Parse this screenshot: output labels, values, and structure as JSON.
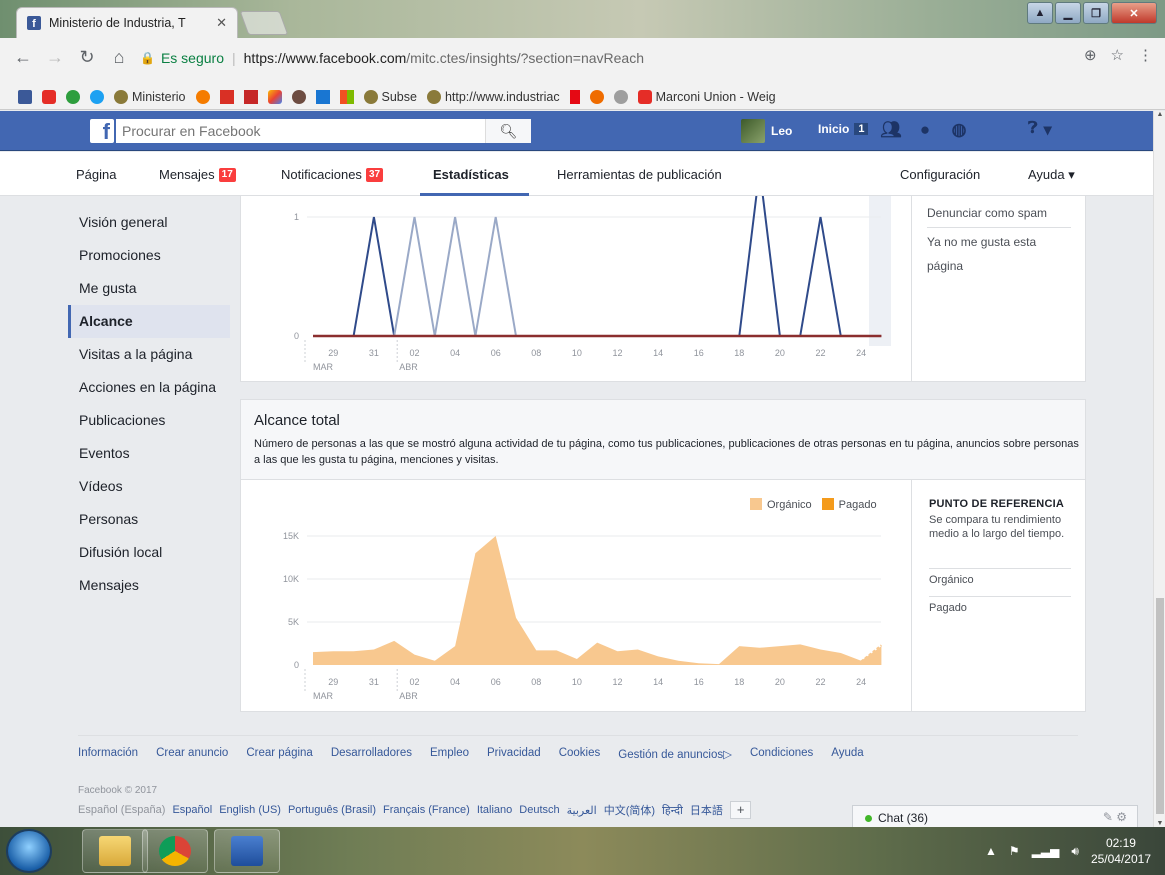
{
  "browser": {
    "tab_title": "Ministerio de Industria, T",
    "tab_close": "✕",
    "secure_label": "Es seguro",
    "url_host": "https://www.facebook.com",
    "url_path": "/mitc.ctes/insights/?section=navReach",
    "bookmarks": [
      "Ministerio",
      "Subse",
      "http://www.industriac",
      "Marconi Union - Weig"
    ]
  },
  "fb": {
    "search_placeholder": "Procurar en Facebook",
    "user_name": "Leo",
    "home_label": "Inicio",
    "home_count": "1"
  },
  "pagenav": {
    "pagina": "Página",
    "mensajes": "Mensajes",
    "mensajes_badge": "17",
    "notificaciones": "Notificaciones",
    "notificaciones_badge": "37",
    "estadisticas": "Estadísticas",
    "herramientas": "Herramientas de publicación",
    "configuracion": "Configuración",
    "ayuda": "Ayuda ▾"
  },
  "sidebar": {
    "items": [
      {
        "label": "Visión general"
      },
      {
        "label": "Promociones"
      },
      {
        "label": "Me gusta"
      },
      {
        "label": "Alcance"
      },
      {
        "label": "Visitas a la página"
      },
      {
        "label": "Acciones en la página"
      },
      {
        "label": "Publicaciones"
      },
      {
        "label": "Eventos"
      },
      {
        "label": "Vídeos"
      },
      {
        "label": "Personas"
      },
      {
        "label": "Difusión local"
      },
      {
        "label": "Mensajes"
      }
    ],
    "active_index": 3
  },
  "panel1": {
    "side_links": [
      "Denunciar como spam",
      "Ya no me gusta esta",
      "página"
    ]
  },
  "panel2": {
    "title": "Alcance total",
    "description": "Número de personas a las que se mostró alguna actividad de tu página, como tus publicaciones, publicaciones de otras personas en tu página, anuncios sobre personas a las que les gusta tu página, menciones y visitas.",
    "legend_organic": "Orgánico",
    "legend_paid": "Pagado",
    "ref_title": "PUNTO DE REFERENCIA",
    "ref_desc": "Se compara tu rendimiento medio a lo largo del tiempo.",
    "ref_organic": "Orgánico",
    "ref_paid": "Pagado"
  },
  "chart_data": [
    {
      "type": "line",
      "x": [
        "28 MAR",
        "29",
        "30",
        "31",
        "01 ABR",
        "02",
        "03",
        "04",
        "05",
        "06",
        "07",
        "08",
        "09",
        "10",
        "11",
        "12",
        "13",
        "14",
        "15",
        "16",
        "17",
        "18",
        "19",
        "20",
        "21",
        "22",
        "23",
        "24",
        "25"
      ],
      "x_tick_labels": [
        "29",
        "31",
        "02",
        "04",
        "06",
        "08",
        "10",
        "12",
        "14",
        "16",
        "18",
        "20",
        "22",
        "24"
      ],
      "x_group_labels": [
        "MAR",
        "ABR"
      ],
      "y_tick_labels": [
        "0",
        "1"
      ],
      "ylim": [
        0,
        1
      ],
      "series": [
        {
          "color": "#2f4a8a",
          "values": [
            0,
            0,
            0,
            1,
            0,
            0,
            0,
            0,
            0,
            0,
            0,
            0,
            0,
            0,
            0,
            0,
            0,
            0,
            0,
            0,
            0,
            0,
            1.4,
            0,
            0,
            1,
            0,
            0,
            0
          ]
        },
        {
          "color": "#9aa9c7",
          "values": [
            0,
            0,
            0,
            0,
            0,
            1,
            0,
            1,
            0,
            1,
            0,
            0,
            0,
            0,
            0,
            0,
            0,
            0,
            0,
            0,
            0,
            0,
            0,
            0,
            0,
            0,
            0,
            0,
            0
          ]
        },
        {
          "color": "#8b2e2e",
          "values": [
            0,
            0,
            0,
            0,
            0,
            0,
            0,
            0,
            0,
            0,
            0,
            0,
            0,
            0,
            0,
            0,
            0,
            0,
            0,
            0,
            0,
            0,
            0,
            0,
            0,
            0,
            0,
            0,
            0
          ]
        }
      ]
    },
    {
      "type": "area",
      "title": "Alcance total",
      "x": [
        "28 MAR",
        "29",
        "30",
        "31",
        "01 ABR",
        "02",
        "03",
        "04",
        "05",
        "06",
        "07",
        "08",
        "09",
        "10",
        "11",
        "12",
        "13",
        "14",
        "15",
        "16",
        "17",
        "18",
        "19",
        "20",
        "21",
        "22",
        "23",
        "24",
        "25"
      ],
      "x_tick_labels": [
        "29",
        "31",
        "02",
        "04",
        "06",
        "08",
        "10",
        "12",
        "14",
        "16",
        "18",
        "20",
        "22",
        "24"
      ],
      "x_group_labels": [
        "MAR",
        "ABR"
      ],
      "y_tick_labels": [
        "0",
        "5K",
        "10K",
        "15K"
      ],
      "ylim": [
        0,
        15000
      ],
      "legend": "top-right",
      "series": [
        {
          "name": "Orgánico",
          "color": "#f8c88f",
          "values": [
            1500,
            1600,
            1600,
            1800,
            2800,
            1200,
            500,
            2200,
            13000,
            15000,
            5500,
            1700,
            1700,
            700,
            2600,
            1600,
            1800,
            1000,
            500,
            200,
            100,
            2200,
            2000,
            2200,
            2400,
            1800,
            1400,
            500,
            2200
          ]
        },
        {
          "name": "Pagado",
          "color": "#f49b1c",
          "values": [
            0,
            0,
            0,
            0,
            0,
            0,
            0,
            0,
            0,
            0,
            0,
            0,
            0,
            0,
            0,
            0,
            0,
            0,
            0,
            0,
            0,
            0,
            0,
            0,
            0,
            0,
            0,
            0,
            0
          ]
        }
      ]
    }
  ],
  "footer": {
    "links": [
      "Información",
      "Crear anuncio",
      "Crear página",
      "Desarrolladores",
      "Empleo",
      "Privacidad",
      "Cookies",
      "Gestión de anuncios▷",
      "Condiciones",
      "Ayuda"
    ],
    "copyright": "Facebook © 2017",
    "current_lang": "Español (España)",
    "langs": [
      "Español",
      "English (US)",
      "Português (Brasil)",
      "Français (France)",
      "Italiano",
      "Deutsch",
      "العربية",
      "中文(简体)",
      "हिन्दी",
      "日本語"
    ],
    "plus": "+",
    "chat_label": "Chat (36)"
  },
  "taskbar": {
    "time": "02:19",
    "date": "25/04/2017"
  }
}
